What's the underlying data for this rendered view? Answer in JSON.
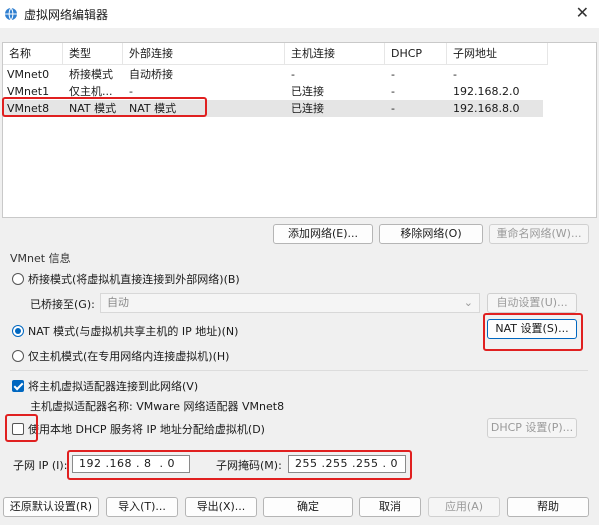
{
  "window": {
    "title": "虚拟网络编辑器",
    "icon": "network-globe-icon",
    "close_glyph": "✕"
  },
  "table": {
    "headers": [
      "名称",
      "类型",
      "外部连接",
      "主机连接",
      "DHCP",
      "子网地址"
    ],
    "rows": [
      [
        "VMnet0",
        "桥接模式",
        "自动桥接",
        "-",
        "-",
        "-"
      ],
      [
        "VMnet1",
        "仅主机...",
        "-",
        "已连接",
        "-",
        "192.168.2.0"
      ],
      [
        "VMnet8",
        "NAT 模式",
        "NAT 模式",
        "已连接",
        "-",
        "192.168.8.0"
      ]
    ]
  },
  "table_buttons": {
    "add": "添加网络(E)...",
    "remove": "移除网络(O)",
    "rename": "重命名网络(W)..."
  },
  "vmnet_info": {
    "title": "VMnet 信息",
    "bridge_option": "桥接模式(将虚拟机直接连接到外部网络)(B)",
    "bridged_to_label": "已桥接至(G):",
    "bridged_to_value": "自动",
    "auto_settings": "自动设置(U)...",
    "nat_option": "NAT 模式(与虚拟机共享主机的 IP 地址)(N)",
    "nat_settings": "NAT 设置(S)...",
    "host_only_option": "仅主机模式(在专用网络内连接虚拟机)(H)",
    "connect_adapter": "将主机虚拟适配器连接到此网络(V)",
    "adapter_name": "主机虚拟适配器名称: VMware 网络适配器 VMnet8",
    "use_dhcp": "使用本地 DHCP 服务将 IP 地址分配给虚拟机(D)",
    "dhcp_settings": "DHCP 设置(P)...",
    "subnet_ip_label": "子网 IP (I):",
    "subnet_ip_value": "192 .168 . 8  . 0",
    "subnet_mask_label": "子网掩码(M):",
    "subnet_mask_value": "255 .255 .255 . 0"
  },
  "state": {
    "selected_mode": "nat",
    "connect_adapter_checked": true,
    "use_dhcp_checked": false,
    "selected_row": 2
  },
  "bottom_buttons": {
    "restore": "还原默认设置(R)",
    "import": "导入(T)...",
    "export": "导出(X)...",
    "ok": "确定",
    "cancel": "取消",
    "apply": "应用(A)",
    "help": "帮助"
  },
  "colors": {
    "accent": "#0067c0",
    "highlight_box": "#e02020"
  }
}
